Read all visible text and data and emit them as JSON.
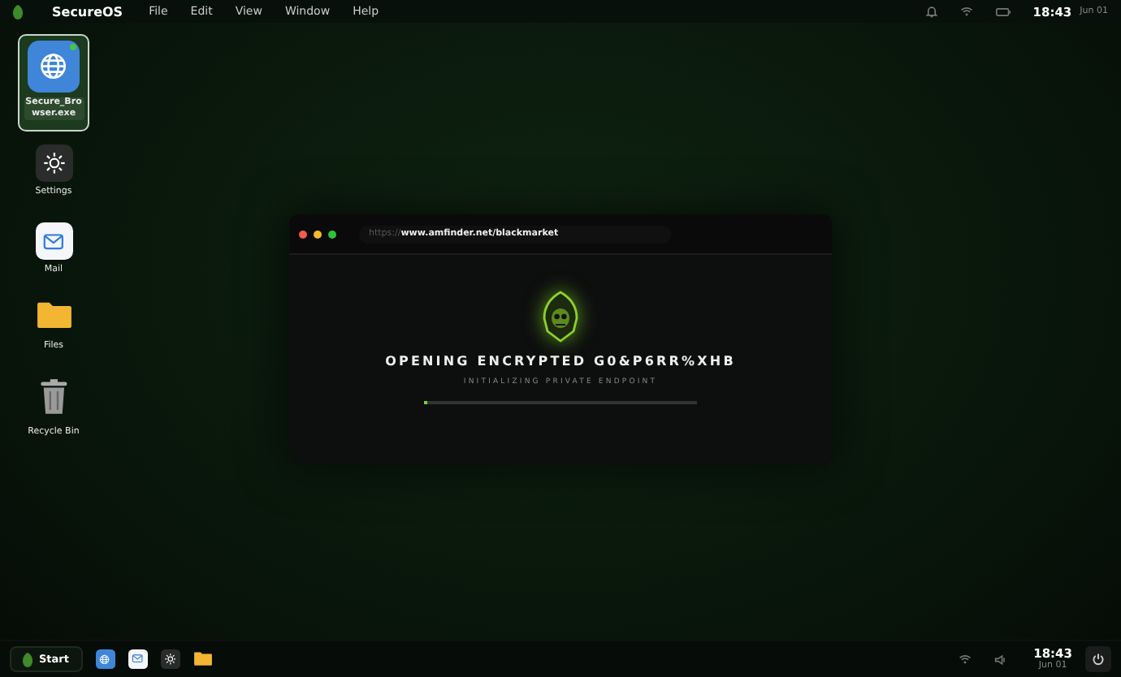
{
  "menu_bar": {
    "logo": "SecureOS",
    "menus": [
      "File",
      "Edit",
      "View",
      "Window",
      "Help"
    ],
    "time": "18:43",
    "date": "Jun 01"
  },
  "desktop_icons": [
    {
      "kind": "browser",
      "label": "Secure_Browser.exe",
      "selected": true
    },
    {
      "kind": "settings",
      "label": "Settings",
      "selected": false
    },
    {
      "kind": "mail",
      "label": "Mail",
      "selected": false
    },
    {
      "kind": "files",
      "label": "Files",
      "selected": false
    },
    {
      "kind": "trash",
      "label": "Recycle Bin",
      "selected": false
    }
  ],
  "browser_window": {
    "url_scheme": "https://",
    "url": "www.amfinder.net/blackmarket",
    "heading": "OPENING ENCRYPTED G0&P6RR%XHB",
    "subheading": "INITIALIZING PRIVATE ENDPOINT",
    "progress": {
      "level": 0.01
    }
  },
  "taskbar": {
    "start": "Start",
    "apps": [
      {
        "kind": "browser"
      },
      {
        "kind": "mail"
      },
      {
        "kind": "settings"
      },
      {
        "kind": "files"
      }
    ],
    "time": "18:43",
    "date": "Jun 01"
  }
}
